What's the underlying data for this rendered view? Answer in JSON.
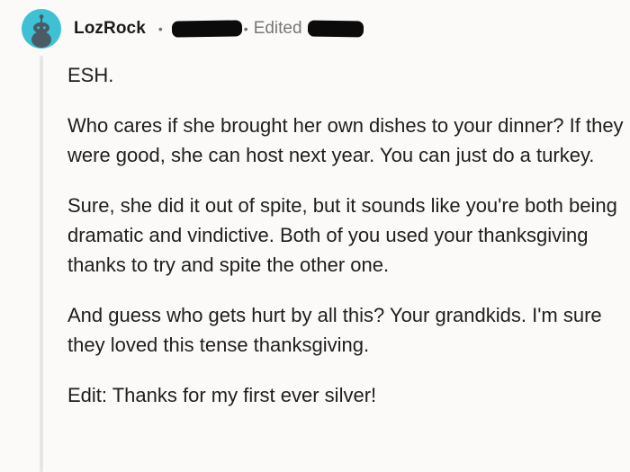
{
  "comment": {
    "author": "LozRock",
    "separator": "•",
    "edited_label": "Edited",
    "avatar_icon": "snoo-avatar-icon",
    "avatar_color": "#3fc1d4",
    "paragraphs": [
      "ESH.",
      "Who cares if she brought her own dishes to your dinner? If they were good, she can host next year. You can just do a turkey.",
      "Sure, she did it out of spite, but it sounds like you're both being dramatic and vindictive. Both of you used your thanksgiving thanks to try and spite the other one.",
      "And guess who gets hurt by all this? Your grandkids. I'm sure they loved this tense thanksgiving.",
      "Edit: Thanks for my first ever silver!"
    ]
  }
}
